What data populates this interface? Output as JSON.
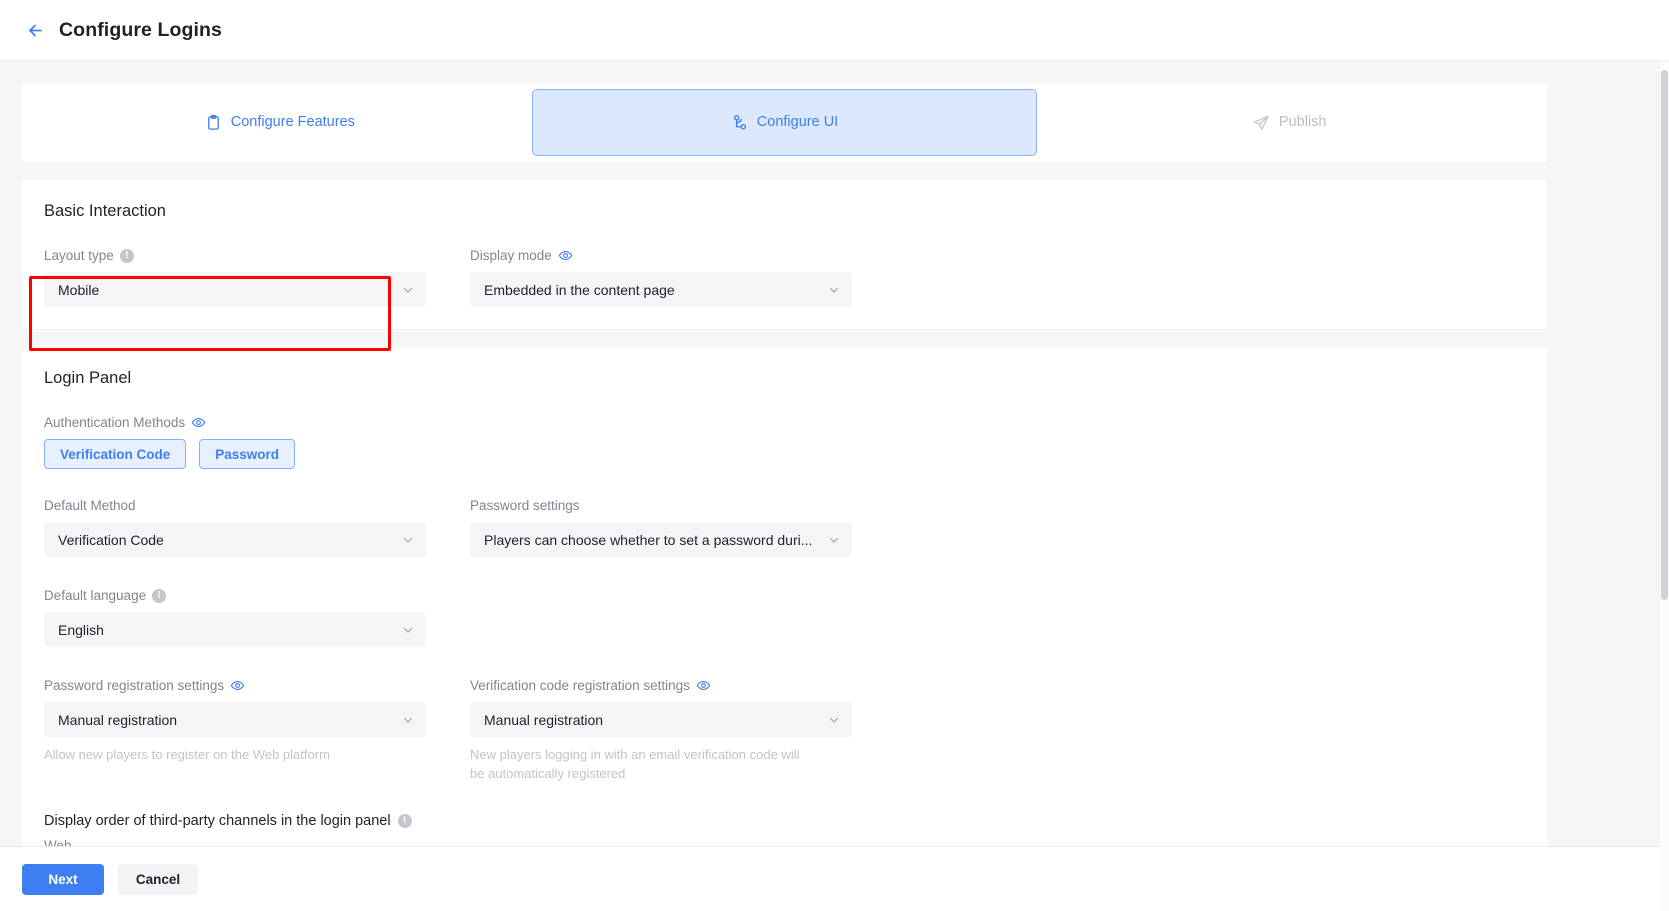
{
  "header": {
    "title": "Configure Logins",
    "back_icon": "arrow-left-icon"
  },
  "steps": [
    {
      "label": "Configure Features",
      "icon": "clipboard-icon",
      "state": "done"
    },
    {
      "label": "Configure UI",
      "icon": "sitemap-icon",
      "state": "active"
    },
    {
      "label": "Publish",
      "icon": "send-icon",
      "state": "todo"
    }
  ],
  "basic_interaction": {
    "title": "Basic Interaction",
    "layout_type": {
      "label": "Layout type",
      "info_icon": "info-icon",
      "value": "Mobile",
      "chevron": "chevron-down-icon"
    },
    "display_mode": {
      "label": "Display mode",
      "eye_icon": "eye-icon",
      "value": "Embedded in the content page",
      "chevron": "chevron-down-icon"
    }
  },
  "login_panel": {
    "title": "Login Panel",
    "auth_methods": {
      "label": "Authentication Methods",
      "eye_icon": "eye-icon",
      "chips": [
        "Verification Code",
        "Password"
      ]
    },
    "default_method": {
      "label": "Default Method",
      "value": "Verification Code",
      "chevron": "chevron-down-icon"
    },
    "password_settings": {
      "label": "Password settings",
      "value": "Players can choose whether to set a password duri...",
      "chevron": "chevron-down-icon"
    },
    "default_language": {
      "label": "Default language",
      "info_icon": "info-icon",
      "value": "English",
      "chevron": "chevron-down-icon"
    },
    "password_registration": {
      "label": "Password registration settings",
      "eye_icon": "eye-icon",
      "value": "Manual registration",
      "chevron": "chevron-down-icon",
      "hint": "Allow new players to register on the Web platform"
    },
    "verification_registration": {
      "label": "Verification code registration settings",
      "eye_icon": "eye-icon",
      "value": "Manual registration",
      "chevron": "chevron-down-icon",
      "hint": "New players logging in with an email verification code will be automatically registered"
    },
    "third_party_order": {
      "label": "Display order of third-party channels in the login panel",
      "info_icon": "info-icon",
      "platform": "Web"
    }
  },
  "footer": {
    "next_label": "Next",
    "cancel_label": "Cancel"
  },
  "colors": {
    "accent": "#3d7ff3",
    "active_step_bg": "#dbe8fd",
    "highlight": "#ff0000",
    "field_bg": "#f4f5f7"
  }
}
